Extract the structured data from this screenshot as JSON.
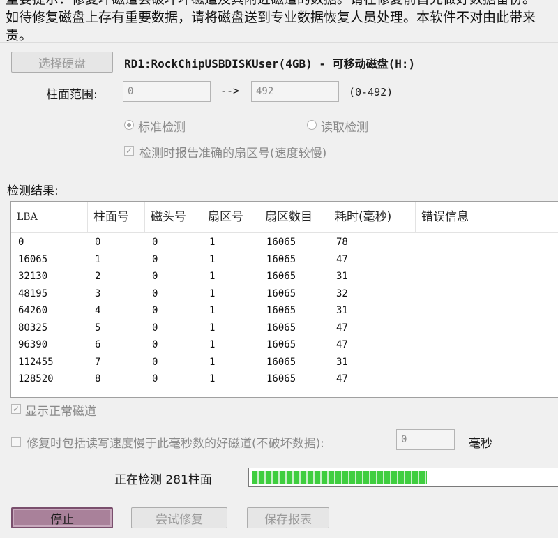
{
  "warning": {
    "line1": "重要提示：修复坏磁道会破坏坏磁道及其附近磁道的数据。请在修复前首先做好数据备份。",
    "line2": "如待修复磁盘上存有重要数据，请将磁盘送到专业数据恢复人员处理。本软件不对由此带来",
    "line3": "责。"
  },
  "disk": {
    "select_button": "选择硬盘",
    "selected": "RD1:RockChipUSBDISKUser(4GB) - 可移动磁盘(H:)"
  },
  "cylinder": {
    "label": "柱面范围:",
    "from": "0",
    "arrow": "-->",
    "to": "492",
    "range_hint": "(0-492)"
  },
  "mode": {
    "standard": "标准检测",
    "read": "读取检测",
    "selected": "standard"
  },
  "report_sector": {
    "label": "检测时报告准确的扇区号(速度较慢)",
    "checked": true
  },
  "results": {
    "title": "检测结果:",
    "columns": [
      "LBA",
      "柱面号",
      "磁头号",
      "扇区号",
      "扇区数目",
      "耗时(毫秒)",
      "错误信息"
    ],
    "rows": [
      [
        "0",
        "0",
        "0",
        "1",
        "16065",
        "78",
        ""
      ],
      [
        "16065",
        "1",
        "0",
        "1",
        "16065",
        "47",
        ""
      ],
      [
        "32130",
        "2",
        "0",
        "1",
        "16065",
        "31",
        ""
      ],
      [
        "48195",
        "3",
        "0",
        "1",
        "16065",
        "32",
        ""
      ],
      [
        "64260",
        "4",
        "0",
        "1",
        "16065",
        "31",
        ""
      ],
      [
        "80325",
        "5",
        "0",
        "1",
        "16065",
        "47",
        ""
      ],
      [
        "96390",
        "6",
        "0",
        "1",
        "16065",
        "47",
        ""
      ],
      [
        "112455",
        "7",
        "0",
        "1",
        "16065",
        "31",
        ""
      ],
      [
        "128520",
        "8",
        "0",
        "1",
        "16065",
        "47",
        ""
      ]
    ]
  },
  "show_normal": {
    "label": "显示正常磁道",
    "checked": true
  },
  "repair_slow": {
    "label": "修复时包括读写速度慢于此毫秒数的好磁道(不破坏数据):",
    "value": "0",
    "unit": "毫秒",
    "checked": false
  },
  "status": {
    "text": "正在检测 281柱面",
    "progress": 0.571
  },
  "actions": {
    "stop": "停止",
    "try_repair": "尝试修复",
    "save_report": "保存报表"
  }
}
